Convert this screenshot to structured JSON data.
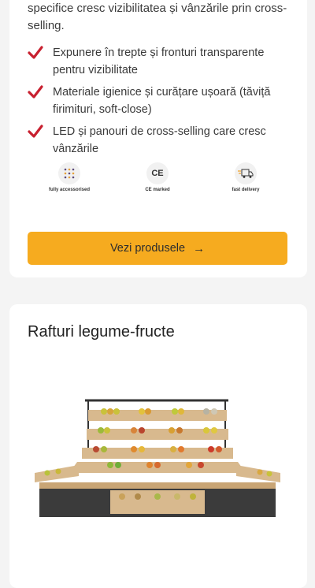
{
  "intro_text": "specifice cresc vizibilitatea și vânzările prin cross-selling.",
  "features": [
    "Expunere în trepte și fronturi transparente pentru vizibilitate",
    "Materiale igienice și curățare ușoară (tăviță firimituri, soft-close)",
    "LED și panouri de cross-selling care cresc vânzările"
  ],
  "badges": [
    {
      "label": "fully accessorised",
      "icon": "grid-dots-icon"
    },
    {
      "label": "CE marked",
      "icon_text": "CE",
      "icon": "ce-mark-icon"
    },
    {
      "label": "fast delivery",
      "icon": "delivery-truck-icon"
    }
  ],
  "cta": {
    "label": "Vezi produsele",
    "arrow": "→"
  },
  "section": {
    "title": "Rafturi legume-fructe"
  },
  "colors": {
    "accent": "#f6ab1f",
    "check": "#c8202f",
    "background": "#f4f4f4"
  }
}
